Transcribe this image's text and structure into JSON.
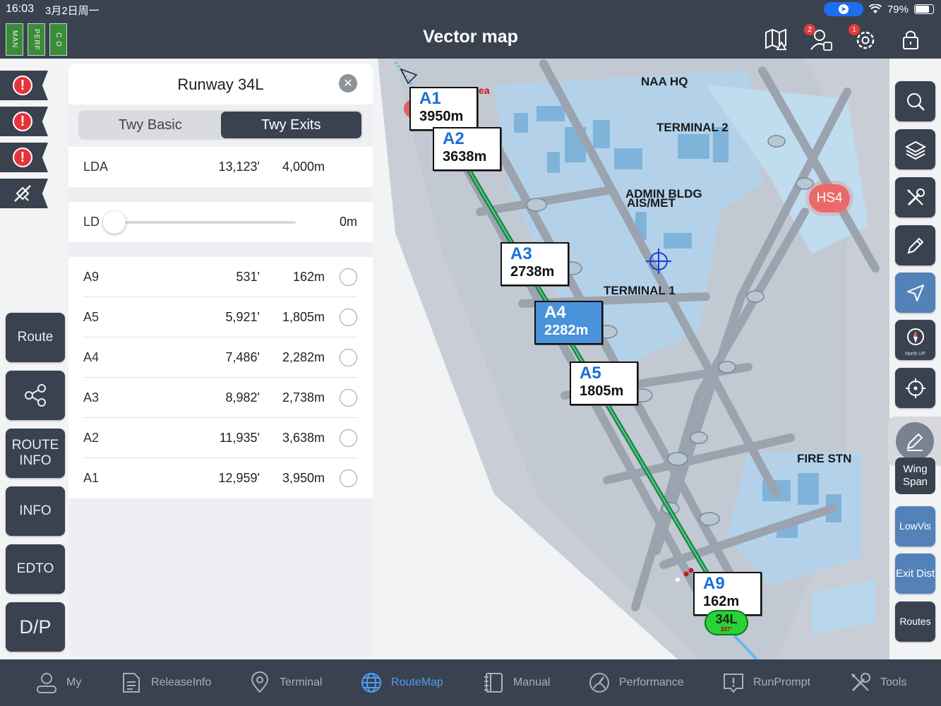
{
  "status": {
    "time": "16:03",
    "date": "3月2日周一",
    "battery": "79%"
  },
  "header": {
    "title": "Vector map",
    "tags": [
      "MAN",
      "PERF",
      "C O"
    ],
    "badges": {
      "crew": "2",
      "settings": "1"
    }
  },
  "panel": {
    "title": "Runway 34L",
    "segments": [
      "Twy Basic",
      "Twy Exits"
    ],
    "active_segment": "Twy Exits",
    "lda": {
      "label": "LDA",
      "ft": "13,123'",
      "m": "4,000m"
    },
    "ld": {
      "label": "LD",
      "value": "0m"
    },
    "exits": [
      {
        "name": "A9",
        "ft": "531'",
        "m": "162m"
      },
      {
        "name": "A5",
        "ft": "5,921'",
        "m": "1,805m"
      },
      {
        "name": "A4",
        "ft": "7,486'",
        "m": "2,282m"
      },
      {
        "name": "A3",
        "ft": "8,982'",
        "m": "2,738m"
      },
      {
        "name": "A2",
        "ft": "11,935'",
        "m": "3,638m"
      },
      {
        "name": "A1",
        "ft": "12,959'",
        "m": "3,950m"
      }
    ]
  },
  "left_buttons": {
    "route": "Route",
    "route_info": "ROUTE INFO",
    "info": "INFO",
    "edto": "EDTO",
    "dp": "D/P"
  },
  "map": {
    "labels": {
      "naa_hq": "NAA HQ",
      "terminal2": "TERMINAL 2",
      "admin": "ADMIN BLDG",
      "aismet": "AIS/MET",
      "terminal1": "TERMINAL 1",
      "fire": "FIRE STN",
      "hotspot": "HS4",
      "area": "ea"
    },
    "exit_boxes": [
      {
        "name": "A1",
        "dist": "3950m"
      },
      {
        "name": "A2",
        "dist": "3638m"
      },
      {
        "name": "A3",
        "dist": "2738m"
      },
      {
        "name": "A4",
        "dist": "2282m"
      },
      {
        "name": "A5",
        "dist": "1805m"
      },
      {
        "name": "A9",
        "dist": "162m"
      }
    ],
    "runway": {
      "name": "34L",
      "heading": "337°"
    }
  },
  "right_toolbar": {
    "north_up": "North UP",
    "wing_span": "Wing Span",
    "lowvis": "LowVis",
    "exit_dist": "Exit Dist",
    "routes": "Routes"
  },
  "tabs": [
    {
      "label": "My",
      "icon": "person-icon"
    },
    {
      "label": "ReleaseInfo",
      "icon": "document-icon"
    },
    {
      "label": "Terminal",
      "icon": "location-pin-icon"
    },
    {
      "label": "RouteMap",
      "icon": "globe-icon"
    },
    {
      "label": "Manual",
      "icon": "book-icon"
    },
    {
      "label": "Performance",
      "icon": "gauge-icon"
    },
    {
      "label": "RunPrompt",
      "icon": "alert-box-icon"
    },
    {
      "label": "Tools",
      "icon": "tools-icon"
    }
  ],
  "active_tab": "RouteMap",
  "colors": {
    "chrome": "#3a4250",
    "accent_blue": "#4f9df2",
    "runway_green": "#1f8a4a",
    "alert_red": "#e8323a",
    "tag_green": "#3d8a3d",
    "selected_exit": "#4a92d9"
  }
}
